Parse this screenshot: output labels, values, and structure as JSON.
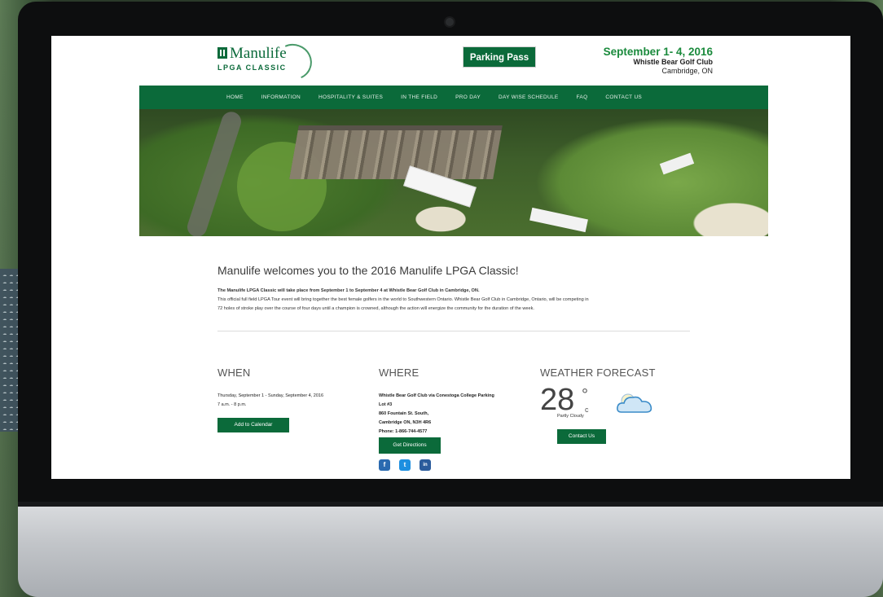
{
  "header": {
    "logo_name": "Manulife",
    "logo_sub": "LPGA CLASSIC",
    "parking_button": "Parking Pass",
    "event_date": "September 1- 4, 2016",
    "event_venue": "Whistle Bear Golf Club",
    "event_city": "Cambridge, ON"
  },
  "nav": {
    "items": [
      "HOME",
      "INFORMATION",
      "HOSPITALITY & SUITES",
      "IN THE FIELD",
      "PRO DAY",
      "DAY WISE SCHEDULE",
      "FAQ",
      "CONTACT US"
    ]
  },
  "welcome": {
    "title": "Manulife welcomes you to the 2016 Manulife LPGA Classic!",
    "body_line1": "The Manulife LPGA Classic will take place from September 1 to September 4 at Whistle Bear Golf Club in Cambridge, ON.",
    "body_line2": "This official full field LPGA Tour event will bring together the best female golfers in the world to Southwestern Ontario. Whistle Bear Golf Club in Cambridge, Ontario, will be competing in",
    "body_line3": "72 holes of stroke play over the course of four days until a champion is crowned, although the action will energize the community for the duration of the week."
  },
  "when": {
    "heading": "WHEN",
    "line1": "Thursday, September 1 - Sunday, September 4, 2016",
    "line2": "7 a.m. - 8 p.m.",
    "button": "Add to Calendar"
  },
  "where": {
    "heading": "WHERE",
    "line1": "Whistle Bear Golf Club via Conestoga College Parking",
    "line2": "Lot #3",
    "line3": "860 Fountain St. South,",
    "line4": "Cambridge ON, N3H 4R6",
    "line5": "Phone: 1-866-744-4577",
    "button": "Get Directions",
    "social": [
      "f",
      "t",
      "in"
    ]
  },
  "weather": {
    "heading": "WEATHER FORECAST",
    "temp": "28",
    "degree": "°",
    "unit": "c",
    "condition": "Partly Cloudy",
    "button": "Contact Us",
    "icon": "partly-cloudy-icon"
  },
  "colors": {
    "brand_green": "#0b6a3a",
    "date_green": "#1a8a3c",
    "social_blue": "#2a6ab0"
  }
}
